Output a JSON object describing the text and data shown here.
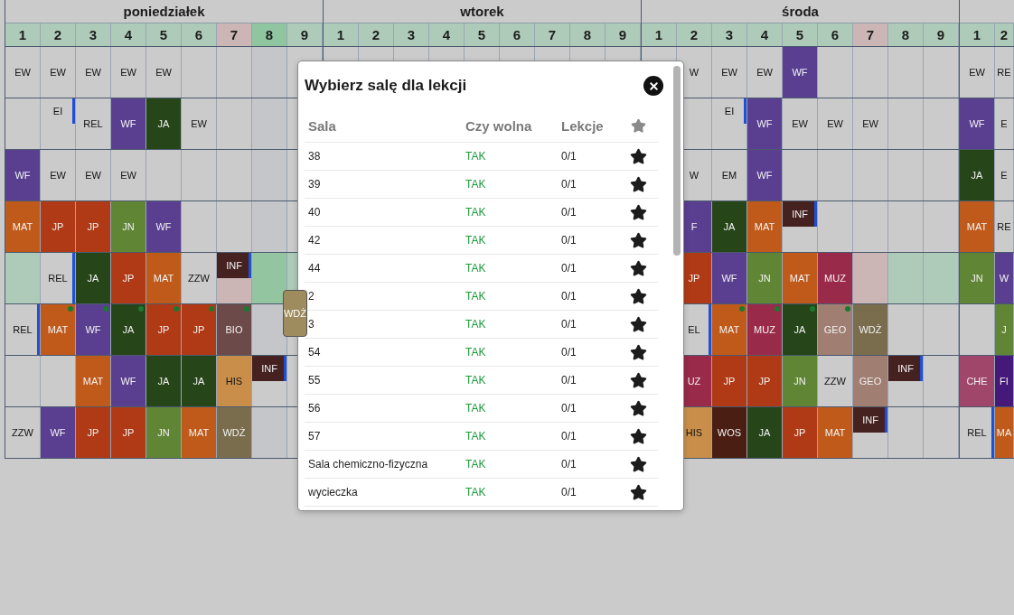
{
  "days": [
    {
      "name": "poniedziałek",
      "periods": [
        {
          "label": "1",
          "color": "#aecbb9"
        },
        {
          "label": "2",
          "color": "#aecbb9"
        },
        {
          "label": "3",
          "color": "#aecbb9"
        },
        {
          "label": "4",
          "color": "#aecbb9"
        },
        {
          "label": "5",
          "color": "#aecbb9"
        },
        {
          "label": "6",
          "color": "#aecbb9"
        },
        {
          "label": "7",
          "color": "#cbb5b5"
        },
        {
          "label": "8",
          "color": "#8fc59f"
        },
        {
          "label": "9",
          "color": "#aecbb9"
        }
      ],
      "rows": [
        [
          {
            "kind": "lesson",
            "text": "EW"
          },
          {
            "kind": "lesson",
            "text": "EW"
          },
          {
            "kind": "lesson",
            "text": "EW"
          },
          {
            "kind": "lesson",
            "text": "EW"
          },
          {
            "kind": "lesson",
            "text": "EW"
          },
          {
            "kind": "empty"
          },
          {
            "kind": "empty"
          },
          {
            "kind": "empty",
            "color": "#c5c6c9"
          },
          {
            "kind": "empty"
          }
        ],
        [
          {
            "kind": "empty"
          },
          {
            "kind": "half",
            "text": "EI",
            "marker": true
          },
          {
            "kind": "lesson",
            "text": "REL"
          },
          {
            "kind": "lesson",
            "text": "WF",
            "color": "#5a3f91"
          },
          {
            "kind": "lesson",
            "text": "JA",
            "color": "#26461a"
          },
          {
            "kind": "lesson",
            "text": "EW"
          },
          {
            "kind": "empty"
          },
          {
            "kind": "empty",
            "color": "#c5c6c9"
          },
          {
            "kind": "empty"
          }
        ],
        [
          {
            "kind": "lesson",
            "text": "WF",
            "color": "#5a3f91"
          },
          {
            "kind": "lesson",
            "text": "EW"
          },
          {
            "kind": "lesson",
            "text": "EW"
          },
          {
            "kind": "lesson",
            "text": "EW"
          },
          {
            "kind": "empty"
          },
          {
            "kind": "empty"
          },
          {
            "kind": "empty"
          },
          {
            "kind": "empty",
            "color": "#c5c6c9"
          },
          {
            "kind": "empty"
          }
        ],
        [
          {
            "kind": "lesson",
            "text": "MAT",
            "color": "#c05a1a"
          },
          {
            "kind": "lesson",
            "text": "JP",
            "color": "#b03a15"
          },
          {
            "kind": "lesson",
            "text": "JP",
            "color": "#b03a15"
          },
          {
            "kind": "lesson",
            "text": "JN",
            "color": "#5f8535"
          },
          {
            "kind": "lesson",
            "text": "WF",
            "color": "#5a3f91"
          },
          {
            "kind": "empty"
          },
          {
            "kind": "empty"
          },
          {
            "kind": "empty",
            "color": "#c5c6c9"
          },
          {
            "kind": "empty"
          }
        ],
        [
          {
            "kind": "empty",
            "color": "#aecbb9"
          },
          {
            "kind": "lesson",
            "text": "REL",
            "marker": true
          },
          {
            "kind": "lesson",
            "text": "JA",
            "color": "#26461a"
          },
          {
            "kind": "lesson",
            "text": "JP",
            "color": "#b03a15"
          },
          {
            "kind": "lesson",
            "text": "MAT",
            "color": "#c05a1a"
          },
          {
            "kind": "lesson",
            "text": "ZZW"
          },
          {
            "kind": "half",
            "color": "#cbb5b5",
            "lesson": {
              "text": "INF",
              "color": "#452220",
              "marker": true
            }
          },
          {
            "kind": "empty",
            "color": "#93c5a0"
          },
          {
            "kind": "empty",
            "color": "#aecbb9"
          }
        ],
        [
          {
            "kind": "lesson",
            "text": "REL",
            "marker": true
          },
          {
            "kind": "lesson",
            "text": "MAT",
            "color": "#c05a1a",
            "dot": true
          },
          {
            "kind": "lesson",
            "text": "WF",
            "color": "#5a3f91",
            "dot": true
          },
          {
            "kind": "lesson",
            "text": "JA",
            "color": "#26461a",
            "dot": true
          },
          {
            "kind": "lesson",
            "text": "JP",
            "color": "#b03a15",
            "dot": true
          },
          {
            "kind": "lesson",
            "text": "JP",
            "color": "#b03a15",
            "dot": true
          },
          {
            "kind": "lesson",
            "text": "BIO",
            "color": "#6d4a4a",
            "dot": true
          },
          {
            "kind": "empty",
            "color": "#c5c6c9"
          },
          {
            "kind": "empty"
          }
        ],
        [
          {
            "kind": "empty"
          },
          {
            "kind": "empty"
          },
          {
            "kind": "lesson",
            "text": "MAT",
            "color": "#c05a1a"
          },
          {
            "kind": "lesson",
            "text": "WF",
            "color": "#5a3f91"
          },
          {
            "kind": "lesson",
            "text": "JA",
            "color": "#26461a"
          },
          {
            "kind": "lesson",
            "text": "JA",
            "color": "#26461a"
          },
          {
            "kind": "lesson",
            "text": "HIS",
            "color": "#c98f4a"
          },
          {
            "kind": "half",
            "text": "INF",
            "color": "#452220",
            "marker": true
          },
          {
            "kind": "empty"
          }
        ],
        [
          {
            "kind": "lesson",
            "text": "ZZW"
          },
          {
            "kind": "lesson",
            "text": "WF",
            "color": "#5a3f91"
          },
          {
            "kind": "lesson",
            "text": "JP",
            "color": "#b03a15"
          },
          {
            "kind": "lesson",
            "text": "JP",
            "color": "#b03a15"
          },
          {
            "kind": "lesson",
            "text": "JN",
            "color": "#5f8535"
          },
          {
            "kind": "lesson",
            "text": "MAT",
            "color": "#c05a1a"
          },
          {
            "kind": "lesson",
            "text": "WDŻ",
            "color": "#7a6d4e"
          },
          {
            "kind": "empty",
            "color": "#c5c6c9"
          },
          {
            "kind": "empty"
          }
        ]
      ]
    },
    {
      "name": "wtorek",
      "periods": [
        {
          "label": "1",
          "color": "#aecbb9"
        },
        {
          "label": "2",
          "color": "#aecbb9"
        },
        {
          "label": "3",
          "color": "#aecbb9"
        },
        {
          "label": "4",
          "color": "#aecbb9"
        },
        {
          "label": "5",
          "color": "#aecbb9"
        },
        {
          "label": "6",
          "color": "#aecbb9"
        },
        {
          "label": "7",
          "color": "#aecbb9"
        },
        {
          "label": "8",
          "color": "#aecbb9"
        },
        {
          "label": "9",
          "color": "#aecbb9"
        }
      ]
    },
    {
      "name": "środa",
      "periods": [
        {
          "label": "1",
          "color": "#aecbb9"
        },
        {
          "label": "2",
          "color": "#aecbb9"
        },
        {
          "label": "3",
          "color": "#aecbb9"
        },
        {
          "label": "4",
          "color": "#aecbb9"
        },
        {
          "label": "5",
          "color": "#aecbb9"
        },
        {
          "label": "6",
          "color": "#aecbb9"
        },
        {
          "label": "7",
          "color": "#cbb5b5"
        },
        {
          "label": "8",
          "color": "#aecbb9"
        },
        {
          "label": "9",
          "color": "#aecbb9"
        }
      ],
      "rows": [
        [
          {
            "kind": "empty"
          },
          {
            "kind": "lesson",
            "text": "W"
          },
          {
            "kind": "lesson",
            "text": "EW"
          },
          {
            "kind": "lesson",
            "text": "EW"
          },
          {
            "kind": "lesson",
            "text": "WF",
            "color": "#5a3f91"
          },
          {
            "kind": "empty"
          },
          {
            "kind": "empty"
          },
          {
            "kind": "empty"
          },
          {
            "kind": "empty"
          }
        ],
        [
          {
            "kind": "empty"
          },
          {
            "kind": "empty"
          },
          {
            "kind": "half",
            "text": "EI",
            "marker": true
          },
          {
            "kind": "lesson",
            "text": "WF",
            "color": "#5a3f91"
          },
          {
            "kind": "lesson",
            "text": "EW"
          },
          {
            "kind": "lesson",
            "text": "EW"
          },
          {
            "kind": "lesson",
            "text": "EW"
          },
          {
            "kind": "empty"
          },
          {
            "kind": "empty"
          }
        ],
        [
          {
            "kind": "empty"
          },
          {
            "kind": "lesson",
            "text": "W"
          },
          {
            "kind": "lesson",
            "text": "EM"
          },
          {
            "kind": "lesson",
            "text": "WF",
            "color": "#5a3f91"
          },
          {
            "kind": "empty"
          },
          {
            "kind": "empty"
          },
          {
            "kind": "empty"
          },
          {
            "kind": "empty"
          },
          {
            "kind": "empty"
          }
        ],
        [
          {
            "kind": "empty"
          },
          {
            "kind": "lesson",
            "text": "F",
            "color": "#5a3f91"
          },
          {
            "kind": "lesson",
            "text": "JA",
            "color": "#26461a"
          },
          {
            "kind": "lesson",
            "text": "MAT",
            "color": "#c05a1a"
          },
          {
            "kind": "half",
            "text": "INF",
            "color": "#452220",
            "marker": true
          },
          {
            "kind": "empty"
          },
          {
            "kind": "empty"
          },
          {
            "kind": "empty"
          },
          {
            "kind": "empty"
          }
        ],
        [
          {
            "kind": "empty"
          },
          {
            "kind": "lesson",
            "text": "JP",
            "color": "#b03a15"
          },
          {
            "kind": "lesson",
            "text": "WF",
            "color": "#5a3f91"
          },
          {
            "kind": "lesson",
            "text": "JN",
            "color": "#5f8535"
          },
          {
            "kind": "lesson",
            "text": "MAT",
            "color": "#c05a1a"
          },
          {
            "kind": "lesson",
            "text": "MUZ",
            "color": "#9a2a4a"
          },
          {
            "kind": "empty",
            "color": "#cbb5b5"
          },
          {
            "kind": "empty",
            "color": "#aecbb9"
          },
          {
            "kind": "empty",
            "color": "#aecbb9"
          }
        ],
        [
          {
            "kind": "empty"
          },
          {
            "kind": "lesson",
            "text": "EL",
            "marker": true
          },
          {
            "kind": "lesson",
            "text": "MAT",
            "color": "#c05a1a",
            "dot": true
          },
          {
            "kind": "lesson",
            "text": "MUZ",
            "color": "#9a2a4a",
            "dot": true
          },
          {
            "kind": "lesson",
            "text": "JA",
            "color": "#26461a",
            "dot": true
          },
          {
            "kind": "lesson",
            "text": "GEO",
            "color": "#a07e72",
            "dot": true
          },
          {
            "kind": "lesson",
            "text": "WDŻ",
            "color": "#7a6d4e"
          },
          {
            "kind": "empty"
          },
          {
            "kind": "empty"
          }
        ],
        [
          {
            "kind": "empty"
          },
          {
            "kind": "lesson",
            "text": "UZ",
            "color": "#9a2a4a"
          },
          {
            "kind": "lesson",
            "text": "JP",
            "color": "#b03a15"
          },
          {
            "kind": "lesson",
            "text": "JP",
            "color": "#b03a15"
          },
          {
            "kind": "lesson",
            "text": "JN",
            "color": "#5f8535"
          },
          {
            "kind": "lesson",
            "text": "ZZW"
          },
          {
            "kind": "lesson",
            "text": "GEO",
            "color": "#a07e72"
          },
          {
            "kind": "half",
            "text": "INF",
            "color": "#452220",
            "marker": true
          },
          {
            "kind": "empty"
          }
        ],
        [
          {
            "kind": "empty"
          },
          {
            "kind": "lesson",
            "text": "HIS",
            "color": "#c98f4a"
          },
          {
            "kind": "lesson",
            "text": "WOS",
            "color": "#4a1e12"
          },
          {
            "kind": "lesson",
            "text": "JA",
            "color": "#26461a"
          },
          {
            "kind": "lesson",
            "text": "JP",
            "color": "#b03a15"
          },
          {
            "kind": "lesson",
            "text": "MAT",
            "color": "#c05a1a"
          },
          {
            "kind": "half",
            "text": "INF",
            "color": "#452220",
            "marker": true
          },
          {
            "kind": "empty"
          },
          {
            "kind": "empty"
          }
        ]
      ]
    },
    {
      "periods": [
        {
          "label": "1",
          "color": "#aecbb9"
        },
        {
          "label": "2",
          "color": "#aecbb9"
        }
      ],
      "rows": [
        [
          {
            "kind": "lesson",
            "text": "EW"
          },
          {
            "kind": "lesson",
            "text": "RE"
          }
        ],
        [
          {
            "kind": "lesson",
            "text": "WF",
            "color": "#5a3f91"
          },
          {
            "kind": "lesson",
            "text": "E"
          }
        ],
        [
          {
            "kind": "lesson",
            "text": "JA",
            "color": "#26461a"
          },
          {
            "kind": "lesson",
            "text": "E"
          }
        ],
        [
          {
            "kind": "lesson",
            "text": "MAT",
            "color": "#c05a1a"
          },
          {
            "kind": "lesson",
            "text": "RE"
          }
        ],
        [
          {
            "kind": "lesson",
            "text": "JN",
            "color": "#5f8535"
          },
          {
            "kind": "lesson",
            "text": "W",
            "color": "#5a3f91"
          }
        ],
        [
          {
            "kind": "empty"
          },
          {
            "kind": "lesson",
            "text": "J",
            "color": "#5f8535"
          }
        ],
        [
          {
            "kind": "lesson",
            "text": "CHE",
            "color": "#a0466a"
          },
          {
            "kind": "lesson",
            "text": "FI",
            "color": "#45197a"
          }
        ],
        [
          {
            "kind": "lesson",
            "text": "REL",
            "marker": true
          },
          {
            "kind": "lesson",
            "text": "MA",
            "color": "#c05a1a"
          }
        ]
      ]
    }
  ],
  "drag_tile": {
    "text": "WDŻ",
    "color": "#9e8b5e"
  },
  "dialog": {
    "title": "Wybierz salę dla lekcji",
    "columns": [
      "Sala",
      "Czy wolna",
      "Lekcje"
    ],
    "rows": [
      {
        "room": "38",
        "free": "TAK",
        "lessons": "0/1"
      },
      {
        "room": "39",
        "free": "TAK",
        "lessons": "0/1"
      },
      {
        "room": "40",
        "free": "TAK",
        "lessons": "0/1"
      },
      {
        "room": "42",
        "free": "TAK",
        "lessons": "0/1"
      },
      {
        "room": "44",
        "free": "TAK",
        "lessons": "0/1"
      },
      {
        "room": "2",
        "free": "TAK",
        "lessons": "0/1"
      },
      {
        "room": "3",
        "free": "TAK",
        "lessons": "0/1"
      },
      {
        "room": "54",
        "free": "TAK",
        "lessons": "0/1"
      },
      {
        "room": "55",
        "free": "TAK",
        "lessons": "0/1"
      },
      {
        "room": "56",
        "free": "TAK",
        "lessons": "0/1"
      },
      {
        "room": "57",
        "free": "TAK",
        "lessons": "0/1"
      },
      {
        "room": "Sala chemiczno-fizyczna",
        "free": "TAK",
        "lessons": "0/1"
      },
      {
        "room": "wycieczka",
        "free": "TAK",
        "lessons": "0/1"
      }
    ]
  }
}
